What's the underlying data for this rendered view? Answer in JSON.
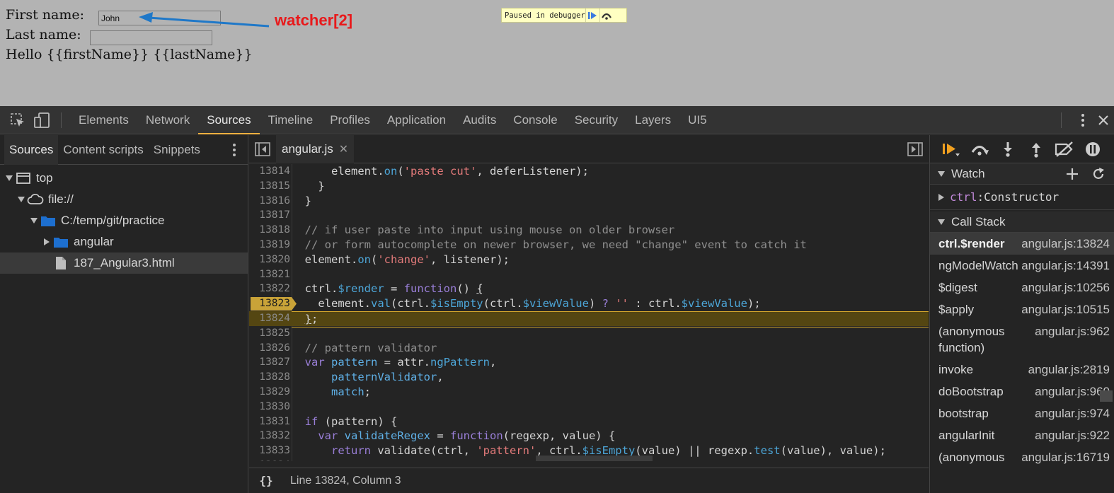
{
  "page": {
    "first_name_label": "First name:",
    "first_name_value": "John",
    "last_name_label": "Last name:",
    "last_name_value": "",
    "hello_line": "Hello {{firstName}} {{lastName}}",
    "annotation": "watcher[2]",
    "paused_text": "Paused in debugger"
  },
  "devtools": {
    "tabs": [
      "Elements",
      "Network",
      "Sources",
      "Timeline",
      "Profiles",
      "Application",
      "Audits",
      "Console",
      "Security",
      "Layers",
      "UI5"
    ],
    "active_tab": "Sources"
  },
  "navigator": {
    "tabs": [
      "Sources",
      "Content scripts",
      "Snippets"
    ],
    "tree": {
      "top": "top",
      "file": "file://",
      "folder": "C:/temp/git/practice",
      "subfolder": "angular",
      "file_item": "187_Angular3.html"
    }
  },
  "editor": {
    "tab_name": "angular.js",
    "status": "Line 13824, Column 3",
    "status_braces": "{}",
    "lines": [
      {
        "n": "13814",
        "h": "      element.<span class='pr'>on</span>(<span class='str'>'paste cut'</span>, deferListener);"
      },
      {
        "n": "13815",
        "h": "    }"
      },
      {
        "n": "13816",
        "h": "  }"
      },
      {
        "n": "13817",
        "h": ""
      },
      {
        "n": "13818",
        "h": "  <span class='cm'>// if user paste into input using mouse on older browser</span>"
      },
      {
        "n": "13819",
        "h": "  <span class='cm'>// or form autocomplete on newer browser, we need \"change\" event to catch it</span>"
      },
      {
        "n": "13820",
        "h": "  element.<span class='pr'>on</span>(<span class='str'>'change'</span>, listener);"
      },
      {
        "n": "13821",
        "h": ""
      },
      {
        "n": "13822",
        "h": "  ctrl.<span class='pr'>$render</span> = <span class='kw'>function</span>() <u>{</u>"
      },
      {
        "n": "13823",
        "h": "    element.<span class='pr'>val</span>(ctrl.<span class='pr'>$isEmpty</span>(ctrl.<span class='pr'>$viewValue</span>) <span class='kw'>?</span> <span class='str'>''</span> : ctrl.<span class='pr'>$viewValue</span>);",
        "bp": true
      },
      {
        "n": "13824",
        "h": "  <u>}</u>;",
        "hl": true
      },
      {
        "n": "13825",
        "h": ""
      },
      {
        "n": "13826",
        "h": "  <span class='cm'>// pattern validator</span>"
      },
      {
        "n": "13827",
        "h": "  <span class='kw'>var</span> <span class='vr'>pattern</span> = attr.<span class='pr'>ngPattern</span>,"
      },
      {
        "n": "13828",
        "h": "      <span class='vr'>patternValidator</span>,"
      },
      {
        "n": "13829",
        "h": "      <span class='vr'>match</span>;"
      },
      {
        "n": "13830",
        "h": ""
      },
      {
        "n": "13831",
        "h": "  <span class='kw'>if</span> (pattern) {"
      },
      {
        "n": "13832",
        "h": "    <span class='kw'>var</span> <span class='vr'>validateRegex</span> = <span class='kw'>function</span>(regexp, value) {"
      },
      {
        "n": "13833",
        "h": "      <span class='kw'>return</span> validate(ctrl, <span class='str'>'pattern'</span>, ctrl.<span class='pr'>$isEmpty</span>(value) || regexp.<span class='pr'>test</span>(value), value);"
      },
      {
        "n": "13834",
        "h": ""
      }
    ]
  },
  "sidebar": {
    "watch_title": "Watch",
    "watch_key": "ctrl",
    "watch_value": "Constructor",
    "callstack_title": "Call Stack",
    "frames": [
      {
        "fn": "ctrl.$render",
        "loc": "angular.js:13824",
        "selected": true
      },
      {
        "fn": "ngModelWatch",
        "loc": "angular.js:14391"
      },
      {
        "fn": "$digest",
        "loc": "angular.js:10256"
      },
      {
        "fn": "$apply",
        "loc": "angular.js:10515"
      },
      {
        "fn": "(anonymous function)",
        "loc": "angular.js:962"
      },
      {
        "fn": "invoke",
        "loc": "angular.js:2819"
      },
      {
        "fn": "doBootstrap",
        "loc": "angular.js:960"
      },
      {
        "fn": "bootstrap",
        "loc": "angular.js:974"
      },
      {
        "fn": "angularInit",
        "loc": "angular.js:922"
      },
      {
        "fn": "(anonymous",
        "loc": "angular.js:16719"
      }
    ]
  },
  "colors": {
    "accent": "#f0b040",
    "annotation": "#e8191b",
    "arrow": "#1f78c8"
  }
}
